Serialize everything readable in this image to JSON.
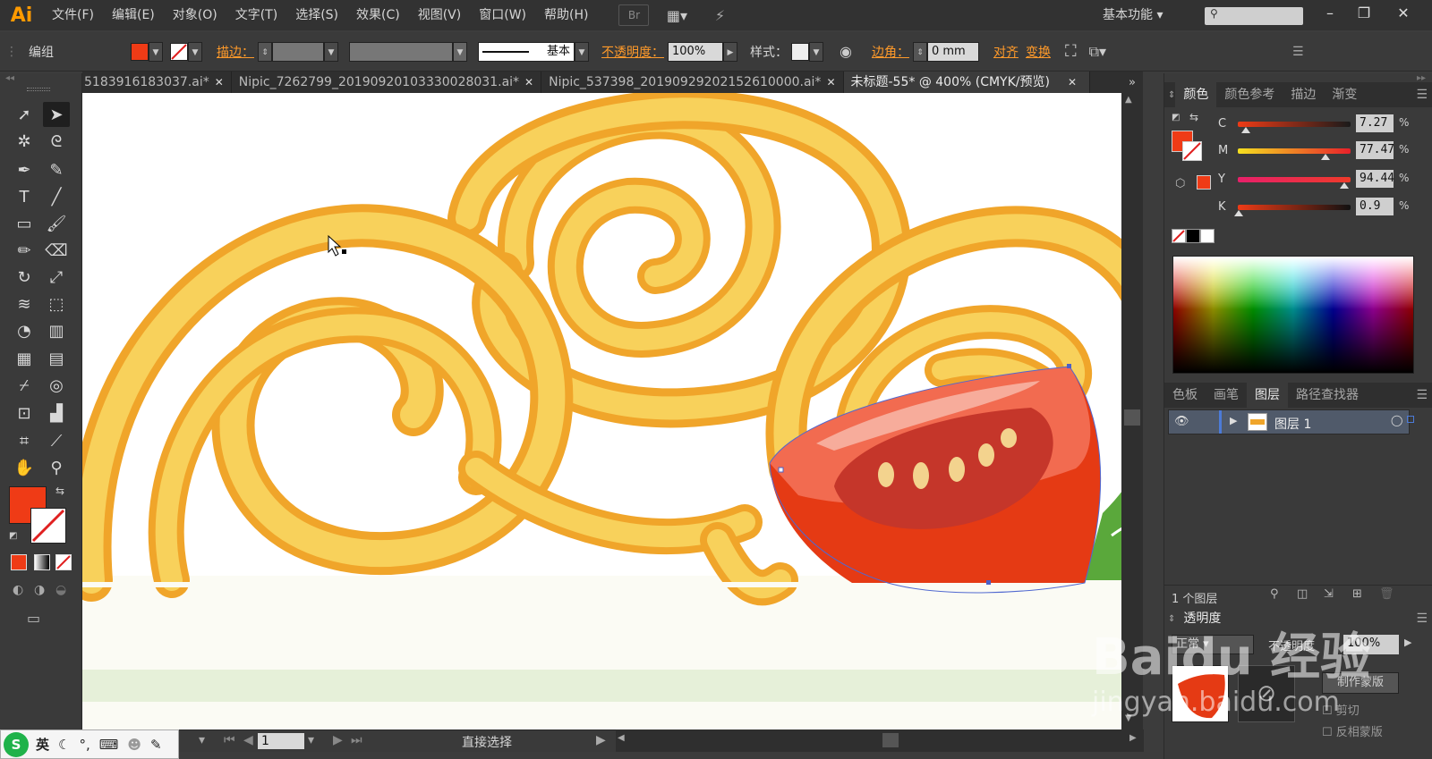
{
  "app": {
    "logo": "Ai"
  },
  "menu": [
    "文件(F)",
    "编辑(E)",
    "对象(O)",
    "文字(T)",
    "选择(S)",
    "效果(C)",
    "视图(V)",
    "窗口(W)",
    "帮助(H)"
  ],
  "menubar": {
    "br_label": "Br",
    "workspace": "基本功能"
  },
  "control": {
    "group_label": "编组",
    "stroke_label": "描边：",
    "stroke_style": "基本",
    "opacity_label": "不透明度：",
    "opacity_value": "100%",
    "style_label": "样式：",
    "corner_label": "边角：",
    "corner_value": "0 mm",
    "align_label": "对齐",
    "transform_label": "变换"
  },
  "tabs": [
    {
      "label": "5183916183037.ai*"
    },
    {
      "label": "Nipic_7262799_20190920103330028031.ai*"
    },
    {
      "label": "Nipic_537398_20190929202152610000.ai*"
    },
    {
      "label": "未标题-55* @ 400% (CMYK/预览)"
    }
  ],
  "status": {
    "page": "1",
    "tool_name": "直接选择"
  },
  "color_panel": {
    "tabs": [
      "颜色",
      "颜色参考",
      "描边",
      "渐变"
    ],
    "cmyk": [
      {
        "label": "C",
        "value": "7.27",
        "fraction": 0.0727
      },
      {
        "label": "M",
        "value": "77.47",
        "fraction": 0.7747
      },
      {
        "label": "Y",
        "value": "94.44",
        "fraction": 0.9444
      },
      {
        "label": "K",
        "value": "0.9",
        "fraction": 0.009
      }
    ],
    "percent": "%"
  },
  "layers_panel": {
    "tabs": [
      "色板",
      "画笔",
      "图层",
      "路径查找器"
    ],
    "layer_name": "图层 1",
    "layer_count": "1 个图层"
  },
  "transparency_panel": {
    "title": "透明度",
    "blend_mode": "正常",
    "opacity_label": "不透明度",
    "opacity_value": "100%",
    "make_mask": "制作蒙版",
    "clip": "剪切",
    "invert": "反相蒙版"
  },
  "ime": {
    "lang": "英"
  },
  "watermark": {
    "brand": "Baidu 经验",
    "url": "jingyan.baidu.com"
  },
  "colors": {
    "fill": "#ef3b16",
    "accent": "#ff9a00",
    "noodle": "#f8d15b",
    "noodle_dark": "#f0a52a"
  }
}
